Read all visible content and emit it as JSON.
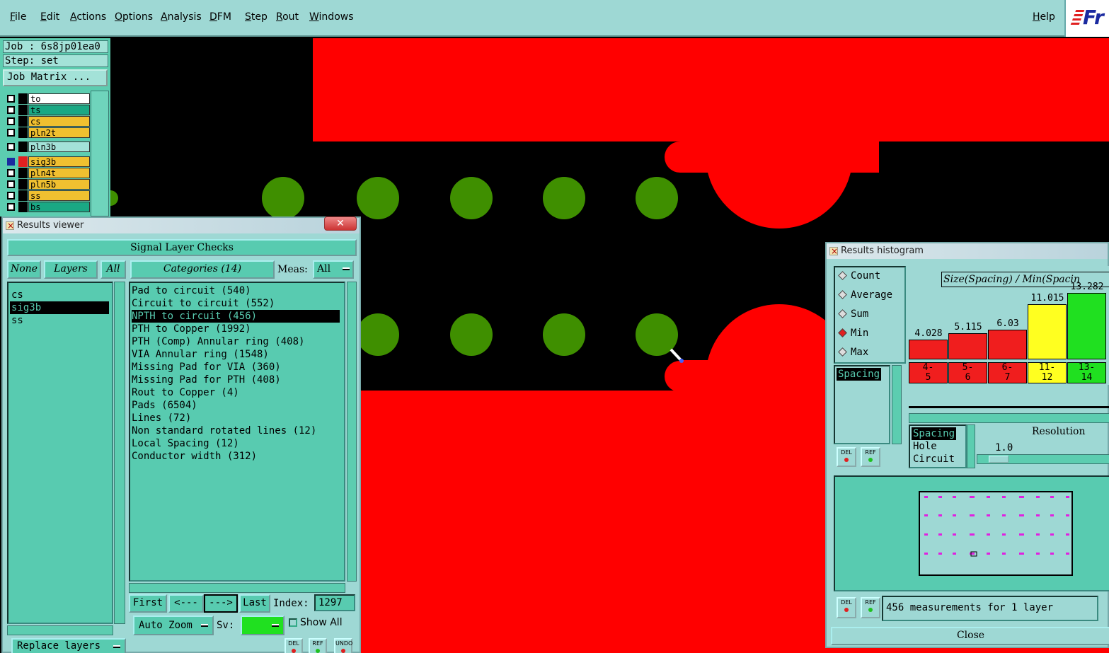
{
  "menubar": {
    "items": [
      "File",
      "Edit",
      "Actions",
      "Options",
      "Analysis",
      "DFM",
      "Step",
      "Rout",
      "Windows"
    ],
    "help": "Help",
    "logo_text": "Fr"
  },
  "left_panel": {
    "job": "Job : 6s8jp01ea0",
    "step": "Step: set",
    "job_matrix_button": "Job Matrix ...",
    "layers": [
      {
        "name": "to",
        "color": "#ffffff",
        "swatch": "#000000"
      },
      {
        "name": "ts",
        "color": "#1aa884",
        "swatch": "#000000"
      },
      {
        "name": "cs",
        "color": "#f0c030",
        "swatch": "#000000"
      },
      {
        "name": "pln2t",
        "color": "#f0c030",
        "swatch": "#000000"
      },
      {
        "name": "pln3b",
        "color": "#a3e2d8",
        "swatch": "#000000"
      },
      {
        "name": "sig3b",
        "color": "#f0c030",
        "swatch": "#e02020"
      },
      {
        "name": "pln4t",
        "color": "#f0c030",
        "swatch": "#000000"
      },
      {
        "name": "pln5b",
        "color": "#f0c030",
        "swatch": "#000000"
      },
      {
        "name": "ss",
        "color": "#f0c030",
        "swatch": "#000000"
      },
      {
        "name": "bs",
        "color": "#1aa884",
        "swatch": "#000000"
      }
    ]
  },
  "results_viewer": {
    "title": "Results viewer",
    "header": "Signal Layer Checks",
    "none_btn": "None",
    "layers_btn": "Layers",
    "all_btn": "All",
    "layers_list": [
      "cs",
      "sig3b",
      "ss"
    ],
    "selected_layer": "sig3b",
    "categories_btn": "Categories (14)",
    "meas_label": "Meas:",
    "meas_value": "All",
    "categories": [
      "Pad to circuit (540)",
      "Circuit to circuit (552)",
      "NPTH to circuit (456)",
      "PTH to Copper (1992)",
      "PTH (Comp) Annular ring (408)",
      "VIA Annular ring (1548)",
      "Missing Pad for VIA (360)",
      "Missing Pad for PTH (408)",
      "Rout to Copper (4)",
      "Pads (6504)",
      "Lines (72)",
      "Non standard rotated lines (12)",
      "Local Spacing (12)",
      "Conductor width (312)"
    ],
    "selected_category": "NPTH to circuit (456)",
    "first_btn": "First",
    "prev_btn": "<---",
    "next_btn": "--->",
    "last_btn": "Last",
    "index_label": "Index:",
    "index_value": "1297",
    "auto_zoom": "Auto Zoom",
    "sv_label": "Sv:",
    "show_all": "Show All",
    "replace_layers": "Replace layers",
    "del": "DEL",
    "ref": "REF",
    "undo": "UNDO"
  },
  "histogram": {
    "title": "Results histogram",
    "modes": [
      "Count",
      "Average",
      "Sum",
      "Min",
      "Max"
    ],
    "selected_mode": "Min",
    "chart_title": "Size(Spacing) / Min(Spacin",
    "measure_list": [
      "Spacing"
    ],
    "bars": [
      {
        "bin": "4-5",
        "value": "4.028",
        "color": "#f01e1e",
        "frac": 0.3
      },
      {
        "bin": "5-6",
        "value": "5.115",
        "color": "#f01e1e",
        "frac": 0.39
      },
      {
        "bin": "6-7",
        "value": "6.03",
        "color": "#f01e1e",
        "frac": 0.45
      },
      {
        "bin": "11-12",
        "value": "11.015",
        "color": "#ffff20",
        "frac": 0.83
      },
      {
        "bin": "13-14",
        "value": "13.282",
        "color": "#20e020",
        "frac": 1.0
      }
    ],
    "res_items": [
      "Spacing",
      "Hole",
      "Circuit"
    ],
    "resolution_label": "Resolution",
    "resolution_value": "1.0",
    "status": "456 measurements for 1 layer",
    "close": "Close",
    "del": "DEL",
    "ref": "REF"
  }
}
